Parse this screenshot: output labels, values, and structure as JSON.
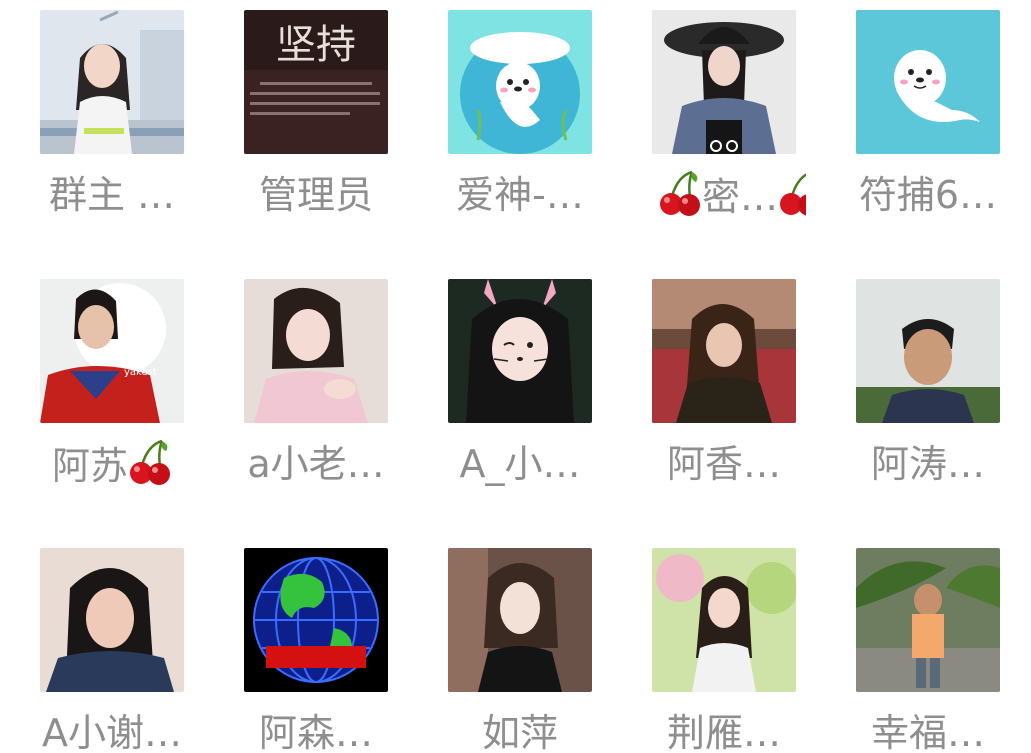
{
  "members": [
    {
      "name": "群主 …",
      "avatar_icon": "user-photo-icon"
    },
    {
      "name": "管理员",
      "avatar_icon": "motivational-text-icon"
    },
    {
      "name": "爱神-…",
      "avatar_icon": "seal-cartoon-icon"
    },
    {
      "name_suffix": "密…",
      "avatar_icon": "user-photo-icon"
    },
    {
      "name": "符捕6…",
      "avatar_icon": "seal-cartoon-icon"
    },
    {
      "name_prefix": "阿苏",
      "avatar_icon": "user-photo-icon"
    },
    {
      "name": "a小老…",
      "avatar_icon": "user-photo-icon"
    },
    {
      "name": "A_小…",
      "avatar_icon": "user-photo-icon"
    },
    {
      "name": "阿香…",
      "avatar_icon": "user-photo-icon"
    },
    {
      "name": "阿涛…",
      "avatar_icon": "user-photo-icon"
    },
    {
      "name": "A小谢…",
      "avatar_icon": "user-photo-icon"
    },
    {
      "name": "阿森…",
      "avatar_icon": "globe-icon"
    },
    {
      "name": "如萍",
      "avatar_icon": "user-photo-icon"
    },
    {
      "name": "荆雁…",
      "avatar_icon": "user-photo-icon"
    },
    {
      "name": "幸福…",
      "avatar_icon": "user-photo-icon"
    }
  ],
  "avatar_texts": {
    "poster_title": "坚持"
  },
  "colors": {
    "name_text": "#8e8e8e",
    "cherry_red": "#d8141e",
    "seal_bg": "#5cc7d8"
  }
}
